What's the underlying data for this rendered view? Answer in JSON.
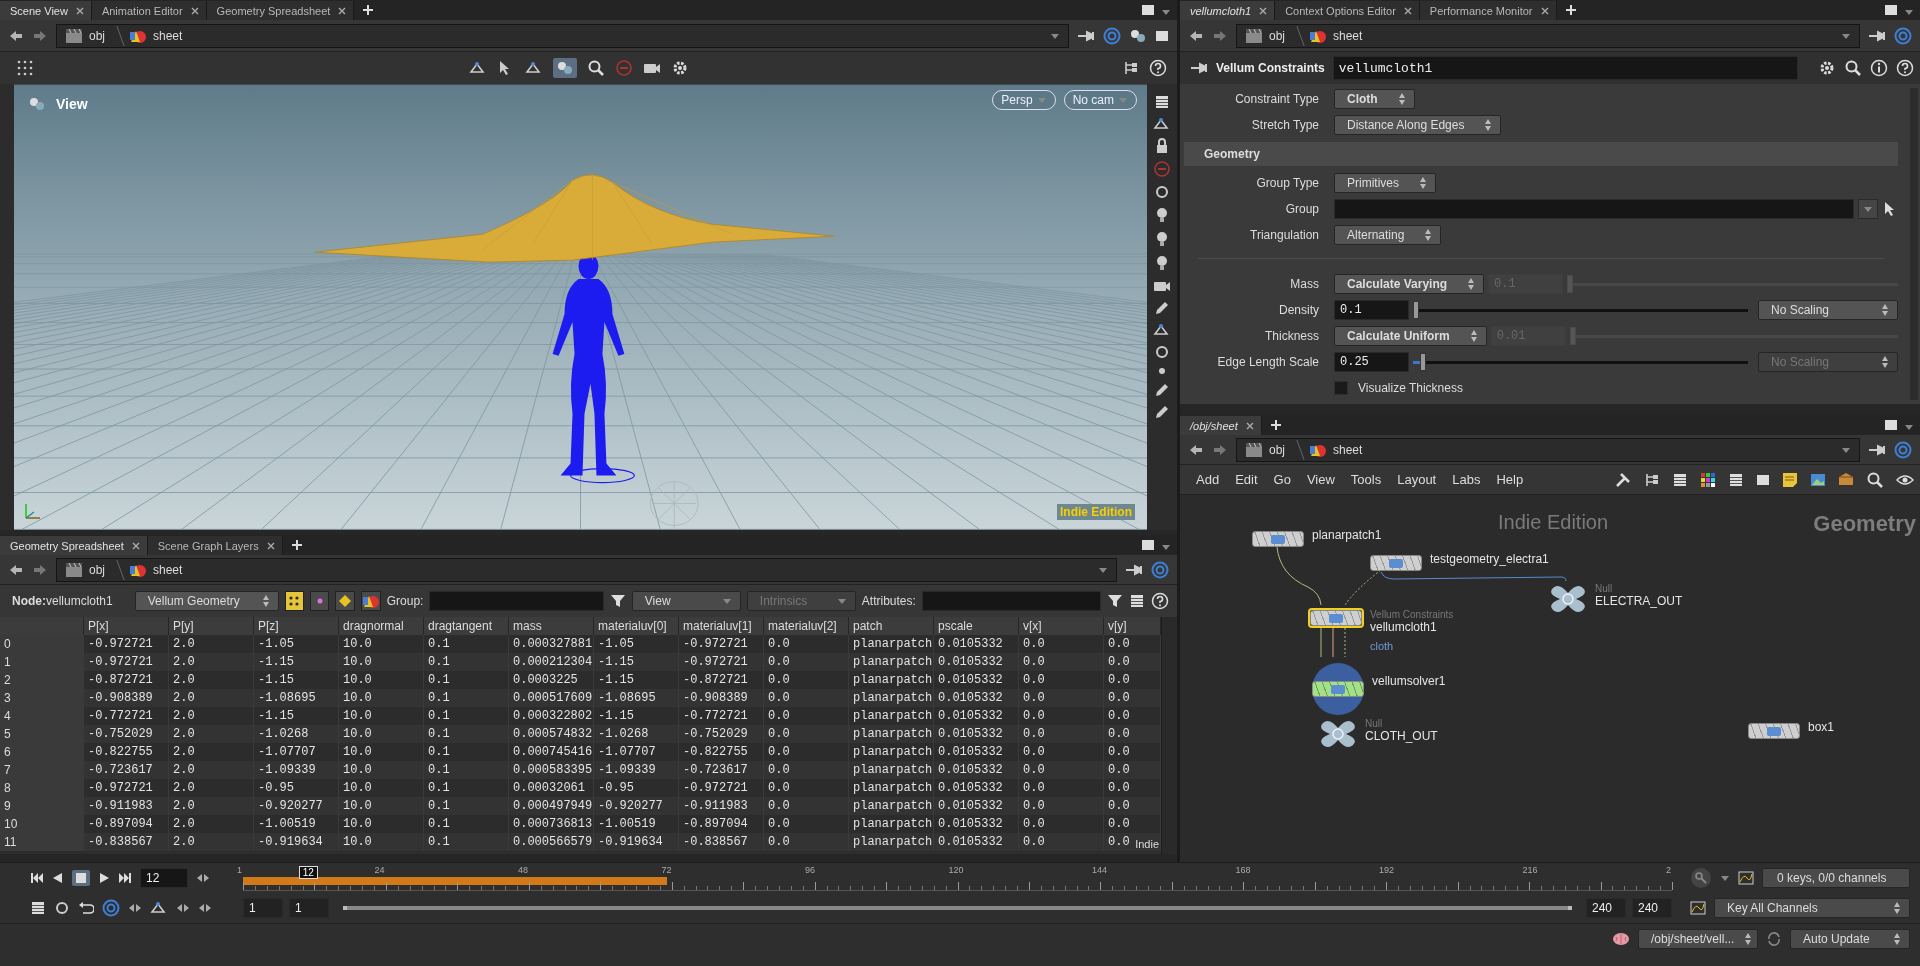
{
  "scene_pane": {
    "tabs": [
      {
        "label": "Scene View",
        "selected": true,
        "node_linked": false
      },
      {
        "label": "Animation Editor",
        "selected": false,
        "node_linked": false
      },
      {
        "label": "Geometry Spreadsheet",
        "selected": false,
        "node_linked": false
      }
    ],
    "path": [
      "obj",
      "sheet"
    ],
    "viewport": {
      "label": "View",
      "view_menus": [
        "Persp",
        "No cam"
      ],
      "edition_text": "Indie Edition"
    }
  },
  "spreadsheet_pane": {
    "tabs": [
      {
        "label": "Geometry Spreadsheet",
        "selected": true,
        "node_linked": false
      },
      {
        "label": "Scene Graph Layers",
        "selected": false,
        "node_linked": false
      }
    ],
    "path": [
      "obj",
      "sheet"
    ],
    "node_text": "**Node:**vellumcloth1",
    "geometry_menu": "Vellum Geometry",
    "attribute_classes": [
      {
        "selected": true
      },
      {
        "selected": false
      },
      {
        "selected": false
      },
      {
        "selected": false
      }
    ],
    "group_label": "Group:",
    "view_menu": {
      "label": "View",
      "disabled": false
    },
    "intrinsics_menu": {
      "label": "Intrinsics",
      "disabled": true
    },
    "attributes_label": "Attributes:",
    "table": {
      "columns": [
        "P[x]",
        "P[y]",
        "P[z]",
        "dragnormal",
        "dragtangent",
        "mass",
        "materialuv[0]",
        "materialuv[1]",
        "materialuv[2]",
        "patch",
        "pscale",
        "v[x]",
        "v[y]"
      ],
      "rows": [
        {
          "index": "0",
          "cells": [
            "-0.972721",
            "2.0",
            "-1.05",
            "10.0",
            "0.1",
            "0.000327881",
            "-1.05",
            "-0.972721",
            "0.0",
            "planarpatch",
            "0.0105332",
            "0.0",
            "0.0"
          ]
        },
        {
          "index": "1",
          "cells": [
            "-0.972721",
            "2.0",
            "-1.15",
            "10.0",
            "0.1",
            "0.000212304",
            "-1.15",
            "-0.972721",
            "0.0",
            "planarpatch",
            "0.0105332",
            "0.0",
            "0.0"
          ]
        },
        {
          "index": "2",
          "cells": [
            "-0.872721",
            "2.0",
            "-1.15",
            "10.0",
            "0.1",
            "0.0003225",
            "-1.15",
            "-0.872721",
            "0.0",
            "planarpatch",
            "0.0105332",
            "0.0",
            "0.0"
          ]
        },
        {
          "index": "3",
          "cells": [
            "-0.908389",
            "2.0",
            "-1.08695",
            "10.0",
            "0.1",
            "0.000517609",
            "-1.08695",
            "-0.908389",
            "0.0",
            "planarpatch",
            "0.0105332",
            "0.0",
            "0.0"
          ]
        },
        {
          "index": "4",
          "cells": [
            "-0.772721",
            "2.0",
            "-1.15",
            "10.0",
            "0.1",
            "0.000322802",
            "-1.15",
            "-0.772721",
            "0.0",
            "planarpatch",
            "0.0105332",
            "0.0",
            "0.0"
          ]
        },
        {
          "index": "5",
          "cells": [
            "-0.752029",
            "2.0",
            "-1.0268",
            "10.0",
            "0.1",
            "0.000574832",
            "-1.0268",
            "-0.752029",
            "0.0",
            "planarpatch",
            "0.0105332",
            "0.0",
            "0.0"
          ]
        },
        {
          "index": "6",
          "cells": [
            "-0.822755",
            "2.0",
            "-1.07707",
            "10.0",
            "0.1",
            "0.000745416",
            "-1.07707",
            "-0.822755",
            "0.0",
            "planarpatch",
            "0.0105332",
            "0.0",
            "0.0"
          ]
        },
        {
          "index": "7",
          "cells": [
            "-0.723617",
            "2.0",
            "-1.09339",
            "10.0",
            "0.1",
            "0.000583395",
            "-1.09339",
            "-0.723617",
            "0.0",
            "planarpatch",
            "0.0105332",
            "0.0",
            "0.0"
          ]
        },
        {
          "index": "8",
          "cells": [
            "-0.972721",
            "2.0",
            "-0.95",
            "10.0",
            "0.1",
            "0.00032061",
            "-0.95",
            "-0.972721",
            "0.0",
            "planarpatch",
            "0.0105332",
            "0.0",
            "0.0"
          ]
        },
        {
          "index": "9",
          "cells": [
            "-0.911983",
            "2.0",
            "-0.920277",
            "10.0",
            "0.1",
            "0.000497949",
            "-0.920277",
            "-0.911983",
            "0.0",
            "planarpatch",
            "0.0105332",
            "0.0",
            "0.0"
          ]
        },
        {
          "index": "10",
          "cells": [
            "-0.897094",
            "2.0",
            "-1.00519",
            "10.0",
            "0.1",
            "0.000736813",
            "-1.00519",
            "-0.897094",
            "0.0",
            "planarpatch",
            "0.0105332",
            "0.0",
            "0.0"
          ]
        },
        {
          "index": "11",
          "cells": [
            "-0.838567",
            "2.0",
            "-0.919634",
            "10.0",
            "0.1",
            "0.000566579",
            "-0.919634",
            "-0.838567",
            "0.0",
            "planarpatch",
            "0.0105332",
            "0.0",
            "0.0"
          ]
        }
      ]
    },
    "edition_text": "Indie"
  },
  "parameter_pane": {
    "tabs": [
      {
        "label": "vellumcloth1",
        "selected": true,
        "node_linked": true
      },
      {
        "label": "Context Options Editor",
        "selected": false,
        "node_linked": false
      },
      {
        "label": "Performance Monitor",
        "selected": false,
        "node_linked": false
      }
    ],
    "path": [
      "obj",
      "sheet"
    ],
    "node_type": "Vellum Constraints",
    "node_name": "vellumcloth1",
    "params": [
      {
        "kind": "menu",
        "label": "Constraint Type",
        "value": "Cloth",
        "non_default": true
      },
      {
        "kind": "menu",
        "label": "Stretch Type",
        "value": "Distance Along Edges",
        "non_default": false
      },
      {
        "kind": "section",
        "label": "Geometry"
      },
      {
        "kind": "menu",
        "label": "Group Type",
        "value": "Primitives",
        "non_default": false
      },
      {
        "kind": "group_field",
        "label": "Group"
      },
      {
        "kind": "menu",
        "label": "Triangulation",
        "value": "Alternating",
        "non_default": false
      },
      {
        "kind": "separator"
      },
      {
        "kind": "menu_slider",
        "label": "Mass",
        "value": "Calculate Varying",
        "non_default": true,
        "field": "0.1",
        "disabled": true,
        "level": 0
      },
      {
        "kind": "field_slider",
        "label": "Density",
        "field": "0.1",
        "level": 0,
        "menu": "No Scaling",
        "menu_disabled": false
      },
      {
        "kind": "menu_slider",
        "label": "Thickness",
        "value": "Calculate Uniform",
        "non_default": true,
        "field": "0.01",
        "disabled": true,
        "level": 0
      },
      {
        "kind": "field_slider",
        "label": "Edge Length Scale",
        "field": "0.25",
        "level": 0.02,
        "menu": "No Scaling",
        "menu_disabled": true
      },
      {
        "kind": "checkbox",
        "label": "Visualize Thickness",
        "checked": false
      }
    ]
  },
  "network_pane": {
    "tabs": [
      {
        "label": "/obj/sheet",
        "selected": true,
        "node_linked": true
      }
    ],
    "path": [
      "obj",
      "sheet"
    ],
    "menu": [
      "Add",
      "Edit",
      "Go",
      "View",
      "Tools",
      "Layout",
      "Labs",
      "Help"
    ],
    "edition_text": "Indie Edition",
    "context_label": "Geometry",
    "nodes": [
      {
        "kind": "sop",
        "name": "planarpatch1",
        "selected": false
      },
      {
        "kind": "sop",
        "name": "testgeometry_electra1",
        "selected": false
      },
      {
        "kind": "sop",
        "name": "vellumcloth1",
        "type_label": "Vellum Constraints",
        "tag": "cloth",
        "selected": true
      },
      {
        "kind": "solver",
        "name": "vellumsolver1",
        "selected": false
      },
      {
        "kind": "null",
        "name": "ELECTRA_OUT",
        "type_label": "Null",
        "selected": false
      },
      {
        "kind": "null",
        "name": "CLOTH_OUT",
        "type_label": "Null",
        "selected": false
      },
      {
        "kind": "sop",
        "name": "box1",
        "selected": false
      }
    ]
  },
  "timeline": {
    "current_frame": "12",
    "playhead": {
      "label": "12",
      "level": 0.046
    },
    "cache": {
      "level": 0.297
    },
    "range_slider": {
      "level": 1
    },
    "ticks": [
      "1",
      "24",
      "48",
      "72",
      "96",
      "120",
      "144",
      "168",
      "192",
      "216",
      "2"
    ],
    "start_frames": [
      "1",
      "1"
    ],
    "end_frames": [
      "240",
      "240"
    ],
    "keys_info": "0 keys, 0/0 channels",
    "key_menu": "Key All Channels"
  },
  "status_bar": {
    "path_menu": "/obj/sheet/vell...",
    "update_menu": "Auto Update"
  }
}
